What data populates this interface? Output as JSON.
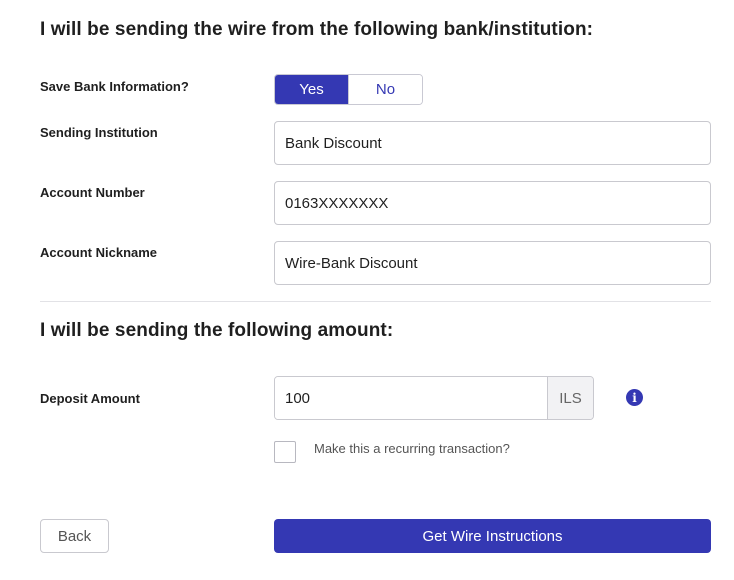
{
  "sections": {
    "bank_title": "I will be sending the wire from the following bank/institution:",
    "amount_title": "I will be sending the following amount:"
  },
  "save_bank": {
    "label": "Save Bank Information?",
    "yes_label": "Yes",
    "no_label": "No",
    "selected": "Yes"
  },
  "sending_institution": {
    "label": "Sending Institution",
    "value": "Bank Discount"
  },
  "account_number": {
    "label": "Account Number",
    "value": "0163XXXXXXX"
  },
  "account_nickname": {
    "label": "Account Nickname",
    "value": "Wire-Bank Discount"
  },
  "deposit": {
    "label": "Deposit Amount",
    "value": "100",
    "currency": "ILS",
    "info_icon": "info-circle-icon"
  },
  "recurring": {
    "label": "Make this a recurring transaction?",
    "checked": false
  },
  "actions": {
    "back_label": "Back",
    "primary_label": "Get Wire Instructions"
  },
  "colors": {
    "accent": "#3438b3",
    "divider": "#e2e2e6",
    "input_border": "#c9c9cf"
  }
}
